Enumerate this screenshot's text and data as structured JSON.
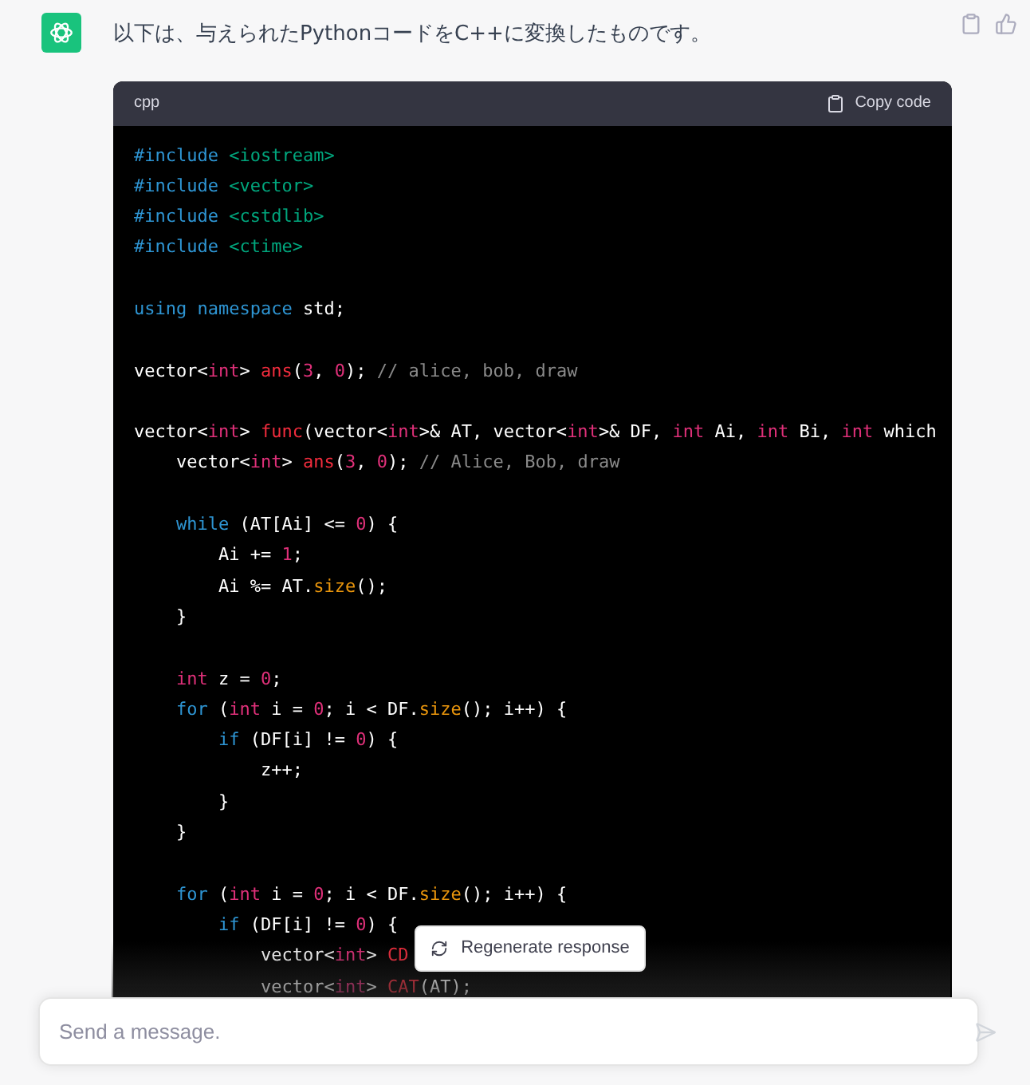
{
  "message": {
    "text": "以下は、与えられたPythonコードをC++に変換したものです。"
  },
  "code_block": {
    "language": "cpp",
    "copy_button": "Copy code",
    "lines": [
      {
        "kind": "code",
        "tokens": [
          {
            "text": "#include",
            "kind": "keyword"
          },
          {
            "text": " <iostream>",
            "kind": "string"
          }
        ]
      },
      {
        "kind": "code",
        "tokens": [
          {
            "text": "#include",
            "kind": "keyword"
          },
          {
            "text": " <vector>",
            "kind": "string"
          }
        ]
      },
      {
        "kind": "code",
        "tokens": [
          {
            "text": "#include",
            "kind": "keyword"
          },
          {
            "text": " <cstdlib>",
            "kind": "string"
          }
        ]
      },
      {
        "kind": "code",
        "tokens": [
          {
            "text": "#include",
            "kind": "keyword"
          },
          {
            "text": " <ctime>",
            "kind": "string"
          }
        ]
      },
      {
        "kind": "blank"
      },
      {
        "kind": "code",
        "tokens": [
          {
            "text": "using",
            "kind": "keyword"
          },
          {
            "text": " namespace",
            "kind": "keyword"
          },
          {
            "text": " std;",
            "kind": "plain"
          }
        ]
      },
      {
        "kind": "blank"
      },
      {
        "kind": "code",
        "tokens": [
          {
            "text": "vector<",
            "kind": "plain"
          },
          {
            "text": "int",
            "kind": "type"
          },
          {
            "text": "> ",
            "kind": "plain"
          },
          {
            "text": "ans",
            "kind": "func"
          },
          {
            "text": "(",
            "kind": "plain"
          },
          {
            "text": "3",
            "kind": "number"
          },
          {
            "text": ", ",
            "kind": "plain"
          },
          {
            "text": "0",
            "kind": "number"
          },
          {
            "text": "); ",
            "kind": "plain"
          },
          {
            "text": "// alice, bob, draw",
            "kind": "comment"
          }
        ]
      },
      {
        "kind": "blank"
      },
      {
        "kind": "code",
        "tokens": [
          {
            "text": "vector<",
            "kind": "plain"
          },
          {
            "text": "int",
            "kind": "type"
          },
          {
            "text": "> ",
            "kind": "plain"
          },
          {
            "text": "func",
            "kind": "func"
          },
          {
            "text": "(vector<",
            "kind": "plain"
          },
          {
            "text": "int",
            "kind": "type"
          },
          {
            "text": ">& AT, vector<",
            "kind": "plain"
          },
          {
            "text": "int",
            "kind": "type"
          },
          {
            "text": ">& DF, ",
            "kind": "plain"
          },
          {
            "text": "int",
            "kind": "type"
          },
          {
            "text": " Ai, ",
            "kind": "plain"
          },
          {
            "text": "int",
            "kind": "type"
          },
          {
            "text": " Bi, ",
            "kind": "plain"
          },
          {
            "text": "int",
            "kind": "type"
          },
          {
            "text": " which",
            "kind": "plain"
          }
        ]
      },
      {
        "kind": "code",
        "tokens": [
          {
            "text": "    vector<",
            "kind": "plain"
          },
          {
            "text": "int",
            "kind": "type"
          },
          {
            "text": "> ",
            "kind": "plain"
          },
          {
            "text": "ans",
            "kind": "func"
          },
          {
            "text": "(",
            "kind": "plain"
          },
          {
            "text": "3",
            "kind": "number"
          },
          {
            "text": ", ",
            "kind": "plain"
          },
          {
            "text": "0",
            "kind": "number"
          },
          {
            "text": "); ",
            "kind": "plain"
          },
          {
            "text": "// Alice, Bob, draw",
            "kind": "comment"
          }
        ]
      },
      {
        "kind": "blank"
      },
      {
        "kind": "code",
        "tokens": [
          {
            "text": "    while",
            "kind": "keyword"
          },
          {
            "text": " (AT[Ai] <= ",
            "kind": "plain"
          },
          {
            "text": "0",
            "kind": "number"
          },
          {
            "text": ") {",
            "kind": "plain"
          }
        ]
      },
      {
        "kind": "code",
        "tokens": [
          {
            "text": "        Ai += ",
            "kind": "plain"
          },
          {
            "text": "1",
            "kind": "number"
          },
          {
            "text": ";",
            "kind": "plain"
          }
        ]
      },
      {
        "kind": "code",
        "tokens": [
          {
            "text": "        Ai %= AT.",
            "kind": "plain"
          },
          {
            "text": "size",
            "kind": "method"
          },
          {
            "text": "();",
            "kind": "plain"
          }
        ]
      },
      {
        "kind": "code",
        "tokens": [
          {
            "text": "    }",
            "kind": "plain"
          }
        ]
      },
      {
        "kind": "blank"
      },
      {
        "kind": "code",
        "tokens": [
          {
            "text": "    int",
            "kind": "type"
          },
          {
            "text": " z = ",
            "kind": "plain"
          },
          {
            "text": "0",
            "kind": "number"
          },
          {
            "text": ";",
            "kind": "plain"
          }
        ]
      },
      {
        "kind": "code",
        "tokens": [
          {
            "text": "    for",
            "kind": "keyword"
          },
          {
            "text": " (",
            "kind": "plain"
          },
          {
            "text": "int",
            "kind": "type"
          },
          {
            "text": " i = ",
            "kind": "plain"
          },
          {
            "text": "0",
            "kind": "number"
          },
          {
            "text": "; i < DF.",
            "kind": "plain"
          },
          {
            "text": "size",
            "kind": "method"
          },
          {
            "text": "(); i++) {",
            "kind": "plain"
          }
        ]
      },
      {
        "kind": "code",
        "tokens": [
          {
            "text": "        if",
            "kind": "keyword"
          },
          {
            "text": " (DF[i] != ",
            "kind": "plain"
          },
          {
            "text": "0",
            "kind": "number"
          },
          {
            "text": ") {",
            "kind": "plain"
          }
        ]
      },
      {
        "kind": "code",
        "tokens": [
          {
            "text": "            z++;",
            "kind": "plain"
          }
        ]
      },
      {
        "kind": "code",
        "tokens": [
          {
            "text": "        }",
            "kind": "plain"
          }
        ]
      },
      {
        "kind": "code",
        "tokens": [
          {
            "text": "    }",
            "kind": "plain"
          }
        ]
      },
      {
        "kind": "blank"
      },
      {
        "kind": "code",
        "tokens": [
          {
            "text": "    for",
            "kind": "keyword"
          },
          {
            "text": " (",
            "kind": "plain"
          },
          {
            "text": "int",
            "kind": "type"
          },
          {
            "text": " i = ",
            "kind": "plain"
          },
          {
            "text": "0",
            "kind": "number"
          },
          {
            "text": "; i < DF.",
            "kind": "plain"
          },
          {
            "text": "size",
            "kind": "method"
          },
          {
            "text": "(); i++) {",
            "kind": "plain"
          }
        ]
      },
      {
        "kind": "code",
        "tokens": [
          {
            "text": "        if",
            "kind": "keyword"
          },
          {
            "text": " (DF[i] != ",
            "kind": "plain"
          },
          {
            "text": "0",
            "kind": "number"
          },
          {
            "text": ") {",
            "kind": "plain"
          }
        ]
      },
      {
        "kind": "code",
        "tokens": [
          {
            "text": "            vector<",
            "kind": "plain"
          },
          {
            "text": "int",
            "kind": "type"
          },
          {
            "text": "> ",
            "kind": "plain"
          },
          {
            "text": "CD",
            "kind": "func"
          }
        ]
      },
      {
        "kind": "code",
        "tokens": [
          {
            "text": "            vector<",
            "kind": "plain"
          },
          {
            "text": "int",
            "kind": "type"
          },
          {
            "text": "> ",
            "kind": "plain"
          },
          {
            "text": "CAT",
            "kind": "func"
          },
          {
            "text": "(AT);",
            "kind": "plain"
          }
        ]
      }
    ]
  },
  "regenerate_button": "Regenerate response",
  "composer": {
    "placeholder": "Send a message."
  }
}
